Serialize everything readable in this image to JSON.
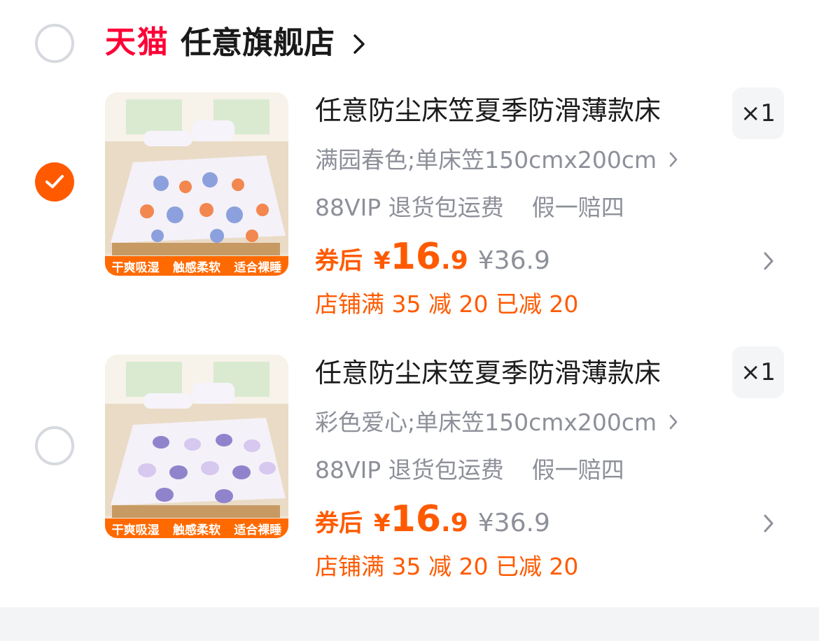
{
  "store": {
    "logo_text": "天猫",
    "name": "任意旗舰店",
    "selected": false
  },
  "items": [
    {
      "selected": true,
      "title": "任意防尘床笠夏季防滑薄款床",
      "quantity": "×1",
      "sku": "满园春色;单床笠150cmx200cm",
      "service_1": "88VIP 退货包运费",
      "service_2": "假一赔四",
      "coupon_label": "券后",
      "currency": "¥",
      "price_int": "16",
      "price_dec": ".9",
      "original_price": "¥36.9",
      "promo": "店铺满 35 减 20 已减 20",
      "image_tags": [
        "干爽吸湿",
        "触感柔软",
        "适合裸睡"
      ],
      "pattern": "flowers"
    },
    {
      "selected": false,
      "title": "任意防尘床笠夏季防滑薄款床",
      "quantity": "×1",
      "sku": "彩色爱心;单床笠150cmx200cm",
      "service_1": "88VIP 退货包运费",
      "service_2": "假一赔四",
      "coupon_label": "券后",
      "currency": "¥",
      "price_int": "16",
      "price_dec": ".9",
      "original_price": "¥36.9",
      "promo": "店铺满 35 减 20 已减 20",
      "image_tags": [
        "干爽吸湿",
        "触感柔软",
        "适合裸睡"
      ],
      "pattern": "hearts"
    }
  ],
  "colors": {
    "accent": "#ff5a00",
    "tmall_red": "#ff0036",
    "muted_text": "#8d9099"
  },
  "icons": {
    "select_circle": "radio-circle-icon",
    "checked": "checkmark-icon",
    "chevron": "chevron-right-icon"
  }
}
